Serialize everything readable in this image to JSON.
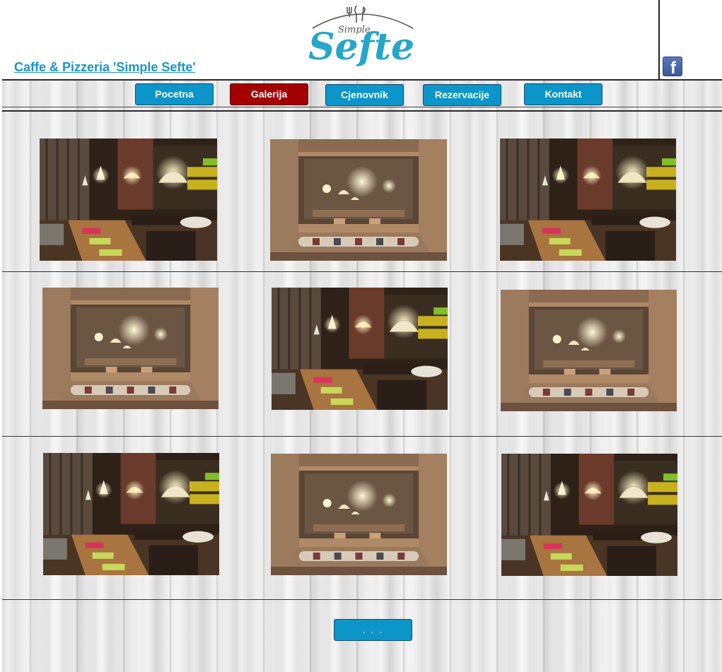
{
  "site": {
    "title": "Caffe & Pizzeria 'Simple Sefte'",
    "logo_script": "Simple",
    "logo_main": "Sefte",
    "facebook_glyph": "f"
  },
  "nav": {
    "items": [
      {
        "label": "Pocetna",
        "active": false
      },
      {
        "label": "Galerija",
        "active": true
      },
      {
        "label": "Cjenovnik",
        "active": false
      },
      {
        "label": "Rezervacije",
        "active": false
      },
      {
        "label": "Kontakt",
        "active": false
      }
    ]
  },
  "gallery": {
    "photos": [
      {
        "scene": "restaurant-interior-lamps"
      },
      {
        "scene": "restaurant-window-view"
      },
      {
        "scene": "restaurant-interior-lamps"
      },
      {
        "scene": "restaurant-window-view"
      },
      {
        "scene": "restaurant-interior-lamps"
      },
      {
        "scene": "restaurant-window-view"
      },
      {
        "scene": "restaurant-interior-lamps"
      },
      {
        "scene": "restaurant-window-view"
      },
      {
        "scene": "restaurant-interior-lamps"
      }
    ],
    "more_label": ". . ."
  },
  "colors": {
    "accent": "#0b95c9",
    "active": "#a40000",
    "link": "#1b95c9"
  }
}
